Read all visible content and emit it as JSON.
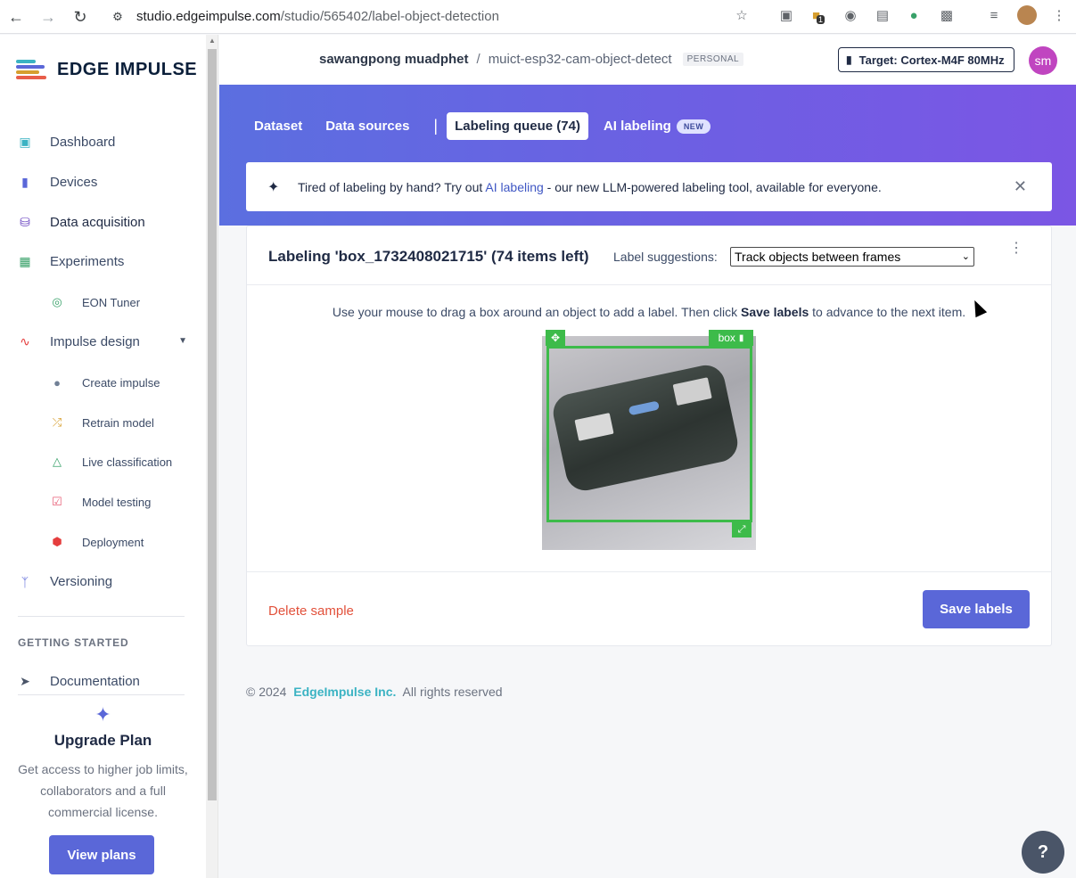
{
  "browser": {
    "url_host": "studio.edgeimpulse.com",
    "url_path": "/studio/565402/label-object-detection",
    "back_icon": "arrow-left-icon",
    "forward_icon": "arrow-right-icon",
    "reload_icon": "reload-icon",
    "ext_badge_count": "1"
  },
  "sidebar": {
    "logo_text": "EDGE IMPULSE",
    "items": [
      {
        "label": "Dashboard",
        "icon": "monitor-icon",
        "color": "#3bb3c3"
      },
      {
        "label": "Devices",
        "icon": "chip-icon",
        "color": "#5a67d8"
      },
      {
        "label": "Data acquisition",
        "icon": "database-icon",
        "color": "#6b46c1"
      },
      {
        "label": "Experiments",
        "icon": "grid-icon",
        "color": "#38a169"
      },
      {
        "label": "EON Tuner",
        "icon": "compass-icon",
        "color": "#38a169"
      },
      {
        "label": "Impulse design",
        "icon": "pulse-icon",
        "color": "#e53e3e"
      },
      {
        "label": "Create impulse",
        "icon": "dot-icon",
        "color": "#718096"
      },
      {
        "label": "Retrain model",
        "icon": "shuffle-icon",
        "color": "#d69e2e"
      },
      {
        "label": "Live classification",
        "icon": "network-icon",
        "color": "#38a169"
      },
      {
        "label": "Model testing",
        "icon": "clipboard-check-icon",
        "color": "#e85d75"
      },
      {
        "label": "Deployment",
        "icon": "cube-icon",
        "color": "#e53e3e"
      },
      {
        "label": "Versioning",
        "icon": "branch-icon",
        "color": "#5a67d8"
      }
    ],
    "getting_started": "GETTING STARTED",
    "documentation": "Documentation",
    "upgrade_title": "Upgrade Plan",
    "upgrade_text": "Get access to higher job limits, collaborators and a full commercial license.",
    "view_plans": "View plans"
  },
  "header": {
    "owner": "sawangpong muadphet",
    "separator": "/",
    "project": "muict-esp32-cam-object-detect",
    "badge": "PERSONAL",
    "target": "Target: Cortex-M4F 80MHz",
    "avatar": "sm"
  },
  "tabs": [
    {
      "label": "Dataset"
    },
    {
      "label": "Data sources"
    },
    {
      "label": "Labeling queue (74)"
    },
    {
      "label": "AI labeling",
      "badge": "NEW"
    }
  ],
  "banner": {
    "text_before": "Tired of labeling by hand? Try out ",
    "link": "AI labeling",
    "text_after": " - our new LLM-powered labeling tool, available for everyone."
  },
  "card": {
    "title": "Labeling 'box_1732408021715' (74 items left)",
    "suggestions_label": "Label suggestions:",
    "suggestions_value": "Track objects between frames",
    "instructions_before": "Use your mouse to drag a box around an object to add a label. Then click ",
    "instructions_bold": "Save labels",
    "instructions_after": " to advance to the next item.",
    "box_label": "box",
    "delete": "Delete sample",
    "save": "Save labels"
  },
  "footer": {
    "copyright": "© 2024",
    "company": "EdgeImpulse Inc.",
    "rights": "All rights reserved"
  },
  "help_icon": "question-icon"
}
